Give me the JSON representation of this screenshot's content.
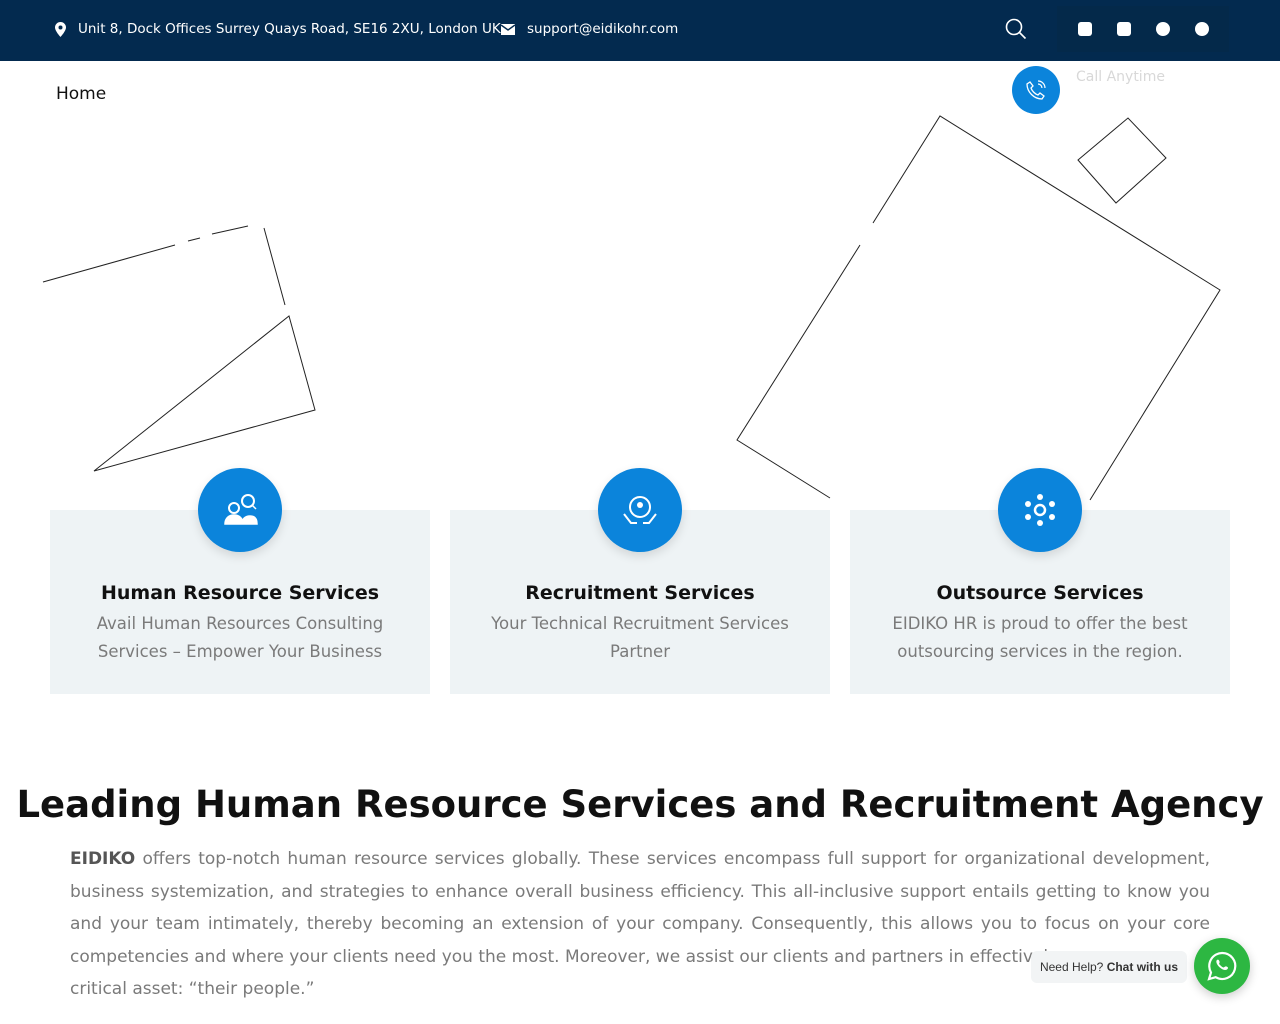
{
  "topbar": {
    "address": "Unit 8, Dock Offices Surrey Quays Road, SE16 2XU, London UK",
    "email": "support@eidikohr.com"
  },
  "nav": {
    "home": "Home",
    "call_label": "Call Anytime"
  },
  "cards": [
    {
      "title": "Human Resource Services",
      "text": "Avail Human Resources Consulting Services – Empower Your Business"
    },
    {
      "title": "Recruitment Services",
      "text": "Your Technical Recruitment Services Partner"
    },
    {
      "title": "Outsource Services",
      "text": "EIDIKO HR is proud to offer the best outsourcing services in the region."
    }
  ],
  "about": {
    "heading": "Leading Human Resource Services and Recruitment Agency",
    "brand": "EIDIKO",
    "body": " offers top-notch human resource services globally. These services encompass full support for organizational development, business systemization, and strategies to enhance overall business efficiency. This all-inclusive support entails getting to know you and your team intimately, thereby becoming an extension of your company. Consequently, this allows you to focus on your core competencies and where your clients need you the most. Moreover, we assist our clients and partners in effectively",
    "body_end": "critical asset: “their people.”"
  },
  "chat": {
    "prefix": "Need Help?",
    "cta": "Chat with us"
  },
  "colors": {
    "topbar": "#032a4f",
    "accent": "#0b84db",
    "whatsapp": "#2db742"
  }
}
